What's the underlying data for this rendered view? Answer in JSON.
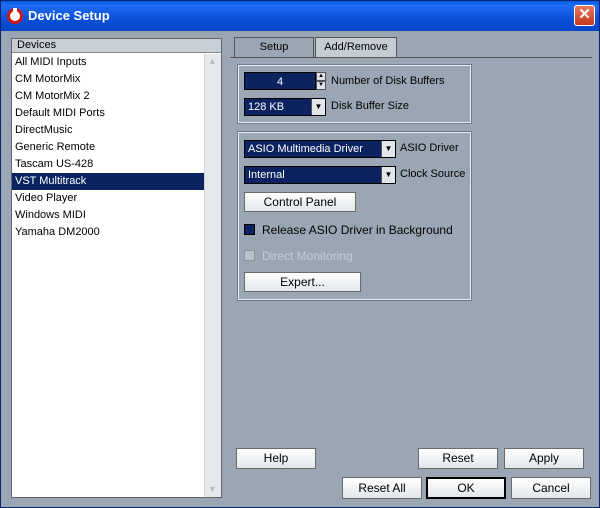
{
  "window": {
    "title": "Device Setup",
    "close_label": "✕"
  },
  "devices": {
    "header": "Devices",
    "items": [
      "All MIDI Inputs",
      "CM MotorMix",
      "CM MotorMix 2",
      "Default MIDI Ports",
      "DirectMusic",
      "Generic Remote",
      "Tascam US-428",
      "VST Multitrack",
      "Video Player",
      "Windows MIDI",
      "Yamaha DM2000"
    ],
    "selected": "VST Multitrack"
  },
  "tabs": [
    {
      "label": "Setup",
      "active": true
    },
    {
      "label": "Add/Remove",
      "active": false
    }
  ],
  "setup": {
    "disk_buffers_value": "4",
    "disk_buffers_label": "Number of Disk Buffers",
    "buffer_size_value": "128 KB",
    "buffer_size_label": "Disk Buffer Size",
    "asio_driver_value": "ASIO Multimedia Driver",
    "asio_driver_label": "ASIO Driver",
    "clock_source_value": "Internal",
    "clock_source_label": "Clock Source",
    "control_panel_label": "Control Panel",
    "release_asio_label": "Release ASIO Driver in Background",
    "release_asio_checked": true,
    "direct_monitoring_label": "Direct Monitoring",
    "direct_monitoring_enabled": false,
    "expert_label": "Expert..."
  },
  "buttons": {
    "help": "Help",
    "reset": "Reset",
    "apply": "Apply",
    "reset_all": "Reset All",
    "ok": "OK",
    "cancel": "Cancel"
  },
  "colors": {
    "titlebar": "#0a5ae8",
    "selection": "#0b2461",
    "panel": "#9aa6b4"
  }
}
